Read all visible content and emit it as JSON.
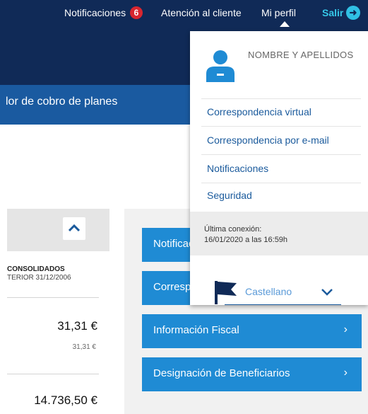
{
  "header": {
    "notifications_label": "Notificaciones",
    "notifications_count": "6",
    "customer_service_label": "Atención al cliente",
    "profile_label": "Mi perfil",
    "logout_label": "Salir"
  },
  "subnav": {
    "text": "lor de cobro de planes"
  },
  "left_panel": {
    "title": "CONSOLIDADOS",
    "subtitle": "TERIOR 31/12/2006",
    "amounts": [
      {
        "main": "31,31 €",
        "secondary": "31,31 €"
      },
      {
        "main": "14.736,50 €"
      }
    ]
  },
  "right_panel": {
    "buttons": [
      {
        "label": "Notificaciones"
      },
      {
        "label": "Correspondencia"
      },
      {
        "label": "Información Fiscal"
      },
      {
        "label": "Designación de Beneficiarios"
      }
    ]
  },
  "profile_menu": {
    "name": "NOMBRE Y APELLIDOS",
    "items": [
      "Correspondencia virtual",
      "Correspondencia por e-mail",
      "Notificaciones",
      "Seguridad"
    ],
    "last_connection_label": "Última conexión:",
    "last_connection_value": "16/01/2020 a las 16:59h",
    "language": "Castellano"
  },
  "colors": {
    "header_bg": "#102a57",
    "subnav_bg": "#1a5aa0",
    "button_blue": "#1f8bd4",
    "badge_red": "#d8262f",
    "logout_cyan": "#35c7e8"
  }
}
